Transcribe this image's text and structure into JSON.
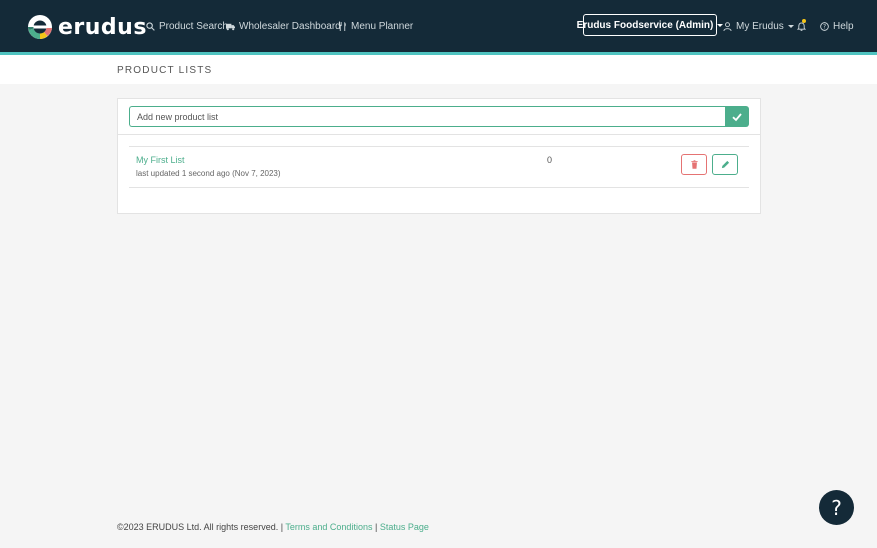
{
  "brand": {
    "name": "erudus"
  },
  "nav": {
    "product_search": "Product Search",
    "wholesaler_dashboard": "Wholesaler Dashboard",
    "menu_planner": "Menu Planner",
    "account": "Erudus Foodservice (Admin)",
    "my_erudus": "My Erudus",
    "help": "Help"
  },
  "page": {
    "title": "PRODUCT LISTS"
  },
  "add_list": {
    "placeholder": "Add new product list",
    "value": ""
  },
  "lists": [
    {
      "name": "My First List",
      "updated": "last updated 1 second ago (Nov 7, 2023)",
      "count": "0"
    }
  ],
  "footer": {
    "copyright": "©2023 ERUDUS Ltd. All rights reserved.",
    "separator": "|",
    "terms": "Terms and Conditions",
    "status": "Status Page"
  },
  "help_fab": {
    "label": "?"
  },
  "colors": {
    "navbar": "#142a38",
    "accent": "#4fc3c0",
    "green": "#4cae8c",
    "danger": "#e57373",
    "notification": "#f5c518"
  },
  "icons": [
    "search-icon",
    "truck-icon",
    "utensils-icon",
    "user-icon",
    "bell-icon",
    "help-circle-icon",
    "check-icon",
    "trash-icon",
    "pencil-icon"
  ]
}
